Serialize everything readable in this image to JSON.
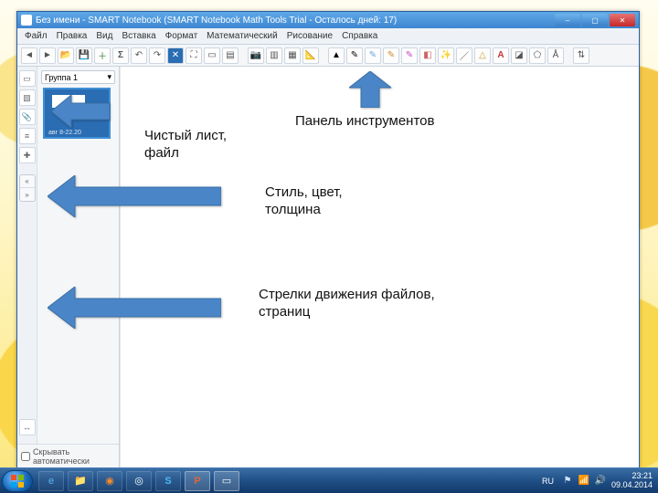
{
  "titlebar": {
    "title": "Без имени - SMART Notebook (SMART Notebook Math Tools Trial - Осталось дней: 17)"
  },
  "menubar": {
    "items": [
      "Файл",
      "Правка",
      "Вид",
      "Вставка",
      "Формат",
      "Математический",
      "Рисование",
      "Справка"
    ]
  },
  "sidebar": {
    "group_label": "Группа 1",
    "thumb_caption": "авг 8-22.20",
    "autohide_label": "Скрывать автоматически"
  },
  "annotations": {
    "toolbar_label": "Панель инструментов",
    "clean_sheet_label": "Чистый лист,\nфайл",
    "style_label": "Стиль, цвет,\nтолщина",
    "nav_arrows_label": "Стрелки движения файлов,\nстраниц"
  },
  "taskbar": {
    "lang": "RU",
    "time": "23:21",
    "date": "09.04.2014"
  }
}
